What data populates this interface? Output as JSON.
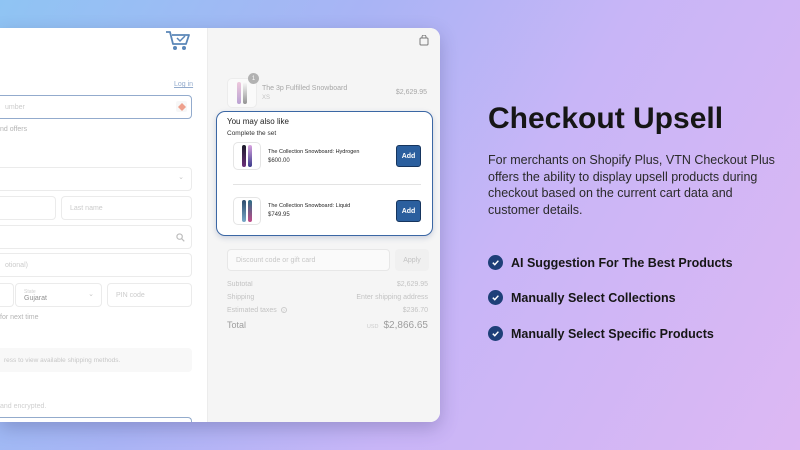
{
  "checkout": {
    "left": {
      "login_link": "Log in",
      "contact_placeholder": "umber",
      "offers_text": "nd offers",
      "first_name_placeholder": "",
      "last_name_placeholder": "Last name",
      "apartment_placeholder": "otional)",
      "state_label": "State",
      "state_value": "Gujarat",
      "pin_placeholder": "PIN code",
      "save_text": "for next time",
      "shipping_text": "ress to view available shipping methods.",
      "encrypted_text": "and encrypted."
    },
    "right": {
      "cart_item": {
        "qty": "1",
        "name": "The 3p Fulfilled Snowboard",
        "variant": "XS",
        "price": "$2,629.95"
      },
      "upsell": {
        "title": "You may also like",
        "subtitle": "Complete the set",
        "products": [
          {
            "name": "The Collection Snowboard: Hydrogen",
            "price": "$600.00",
            "button": "Add"
          },
          {
            "name": "The Collection Snowboard: Liquid",
            "price": "$749.95",
            "button": "Add"
          }
        ]
      },
      "discount_placeholder": "Discount code or gift card",
      "apply_label": "Apply",
      "subtotal_label": "Subtotal",
      "subtotal_value": "$2,629.95",
      "shipping_label": "Shipping",
      "shipping_value": "Enter shipping address",
      "taxes_label": "Estimated taxes",
      "taxes_value": "$236.70",
      "total_label": "Total",
      "currency": "USD",
      "total_value": "$2,866.65"
    }
  },
  "marketing": {
    "heading": "Checkout Upsell",
    "description": "For merchants on Shopify Plus, VTN Checkout Plus offers the ability to display upsell products during checkout based on the current cart data and customer details.",
    "features": [
      "AI Suggestion For The Best Products",
      "Manually Select Collections",
      "Manually Select Specific Products"
    ]
  },
  "colors": {
    "accent": "#2b5f9e",
    "check": "#1e3f78",
    "upsell_border": "#3b67a4"
  }
}
